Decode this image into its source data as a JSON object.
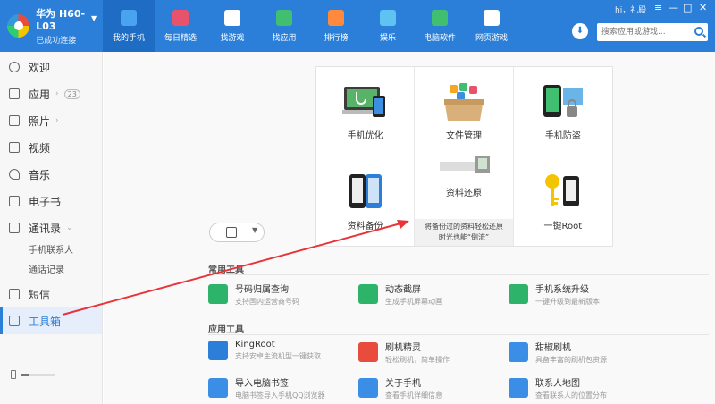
{
  "device": {
    "name": "华为 H60-L03",
    "status": "已成功连接"
  },
  "nav": [
    {
      "label": "我的手机",
      "color": "#4aa3f0",
      "active": true
    },
    {
      "label": "每日精选",
      "color": "#e8526a"
    },
    {
      "label": "找游戏",
      "color": "#ffffff"
    },
    {
      "label": "找应用",
      "color": "#3fbf6f"
    },
    {
      "label": "排行榜",
      "color": "#ff8a3d"
    },
    {
      "label": "娱乐",
      "color": "#5ec3f2"
    },
    {
      "label": "电脑软件",
      "color": "#3fbf6f"
    },
    {
      "label": "网页游戏",
      "color": "#ffffff"
    }
  ],
  "header": {
    "greeting": "hi，礼殿",
    "search_placeholder": "搜索应用或游戏..."
  },
  "window_controls": [
    "≡",
    "—",
    "□",
    "✕"
  ],
  "sidebar": {
    "items": [
      {
        "label": "欢迎"
      },
      {
        "label": "应用",
        "badge": "23",
        "arrow": "›"
      },
      {
        "label": "照片",
        "arrow": "›"
      },
      {
        "label": "视频"
      },
      {
        "label": "音乐"
      },
      {
        "label": "电子书"
      },
      {
        "label": "通讯录",
        "arrow": "⌄"
      },
      {
        "label": "短信"
      },
      {
        "label": "工具箱",
        "active": true
      }
    ],
    "contacts_sub": [
      "手机联系人",
      "通话记录"
    ],
    "storage_used": 0.2
  },
  "tiles": [
    {
      "label": "手机优化"
    },
    {
      "label": "文件管理"
    },
    {
      "label": "手机防盗"
    },
    {
      "label": "资料备份"
    },
    {
      "label": "资料还原",
      "tip_line1": "将备份过的资料轻松还原",
      "tip_line2": "时光也能“倒流”"
    },
    {
      "label": "一键Root"
    }
  ],
  "sections": {
    "common": "常用工具",
    "apps": "应用工具"
  },
  "common_tools": [
    {
      "name": "号码归属查询",
      "desc": "支持国内运营商号码",
      "color": "#2db36a"
    },
    {
      "name": "动态截屏",
      "desc": "生成手机屏幕动画",
      "color": "#2db36a"
    },
    {
      "name": "手机系统升级",
      "desc": "一键升级到最新版本",
      "color": "#2db36a"
    }
  ],
  "app_tools": [
    {
      "name": "KingRoot",
      "desc": "支持安卓主流机型一键获取...",
      "color": "#2b7fd8"
    },
    {
      "name": "刷机精灵",
      "desc": "轻松刷机，简单操作",
      "color": "#e74c3c"
    },
    {
      "name": "甜椒刷机",
      "desc": "具备丰富的刷机包资源",
      "color": "#3a8ee6"
    },
    {
      "name": "导入电脑书签",
      "desc": "电脑书签导入手机QQ浏览器",
      "color": "#3a8ee6"
    },
    {
      "name": "关于手机",
      "desc": "查看手机详细信息",
      "color": "#3a8ee6"
    },
    {
      "name": "联系人地图",
      "desc": "查看联系人的位置分布",
      "color": "#3a8ee6"
    }
  ]
}
